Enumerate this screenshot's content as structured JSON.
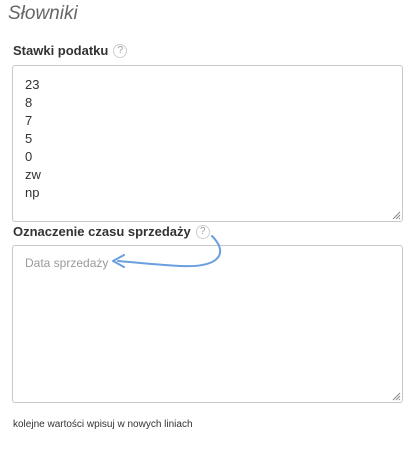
{
  "page": {
    "title": "Słowniki"
  },
  "tax_rates": {
    "label": "Stawki podatku",
    "help_icon": "question-icon",
    "values": [
      "23",
      "8",
      "7",
      "5",
      "0",
      "zw",
      "np"
    ]
  },
  "sale_time": {
    "label": "Oznaczenie czasu sprzedaży",
    "help_icon": "question-icon",
    "value": "",
    "placeholder": "Data sprzedaży"
  },
  "hint": "kolejne wartości wpisuj w nowych liniach",
  "colors": {
    "accent_arrow": "#6a9fdf"
  }
}
